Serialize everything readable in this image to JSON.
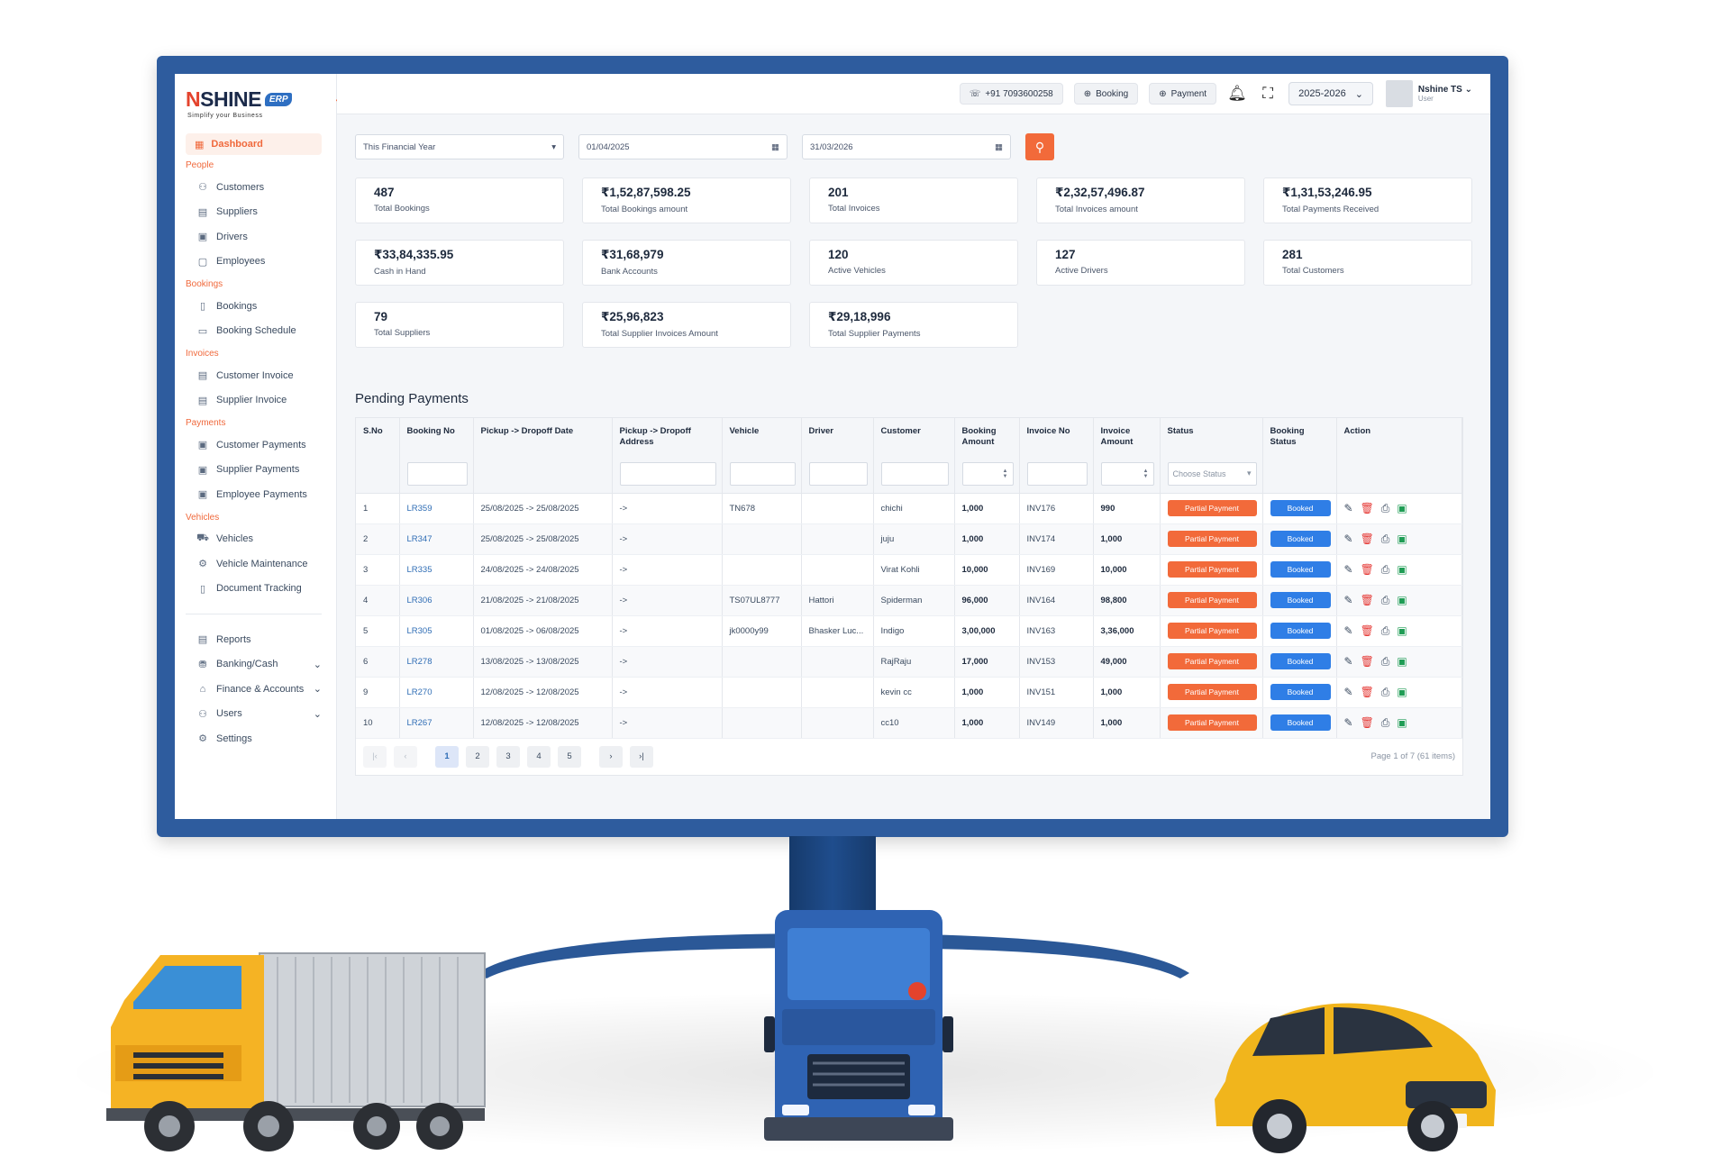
{
  "brand": {
    "name_initial": "N",
    "name_rest": "SHINE",
    "badge": "ERP",
    "tagline": "Simplify your Business"
  },
  "topbar": {
    "phone": "+91 7093600258",
    "booking_label": "Booking",
    "payment_label": "Payment",
    "year": "2025-2026",
    "user_name": "Nshine TS",
    "user_role": "User"
  },
  "sidebar": {
    "active": "Dashboard",
    "groups": [
      {
        "title": "People",
        "items": [
          "Customers",
          "Suppliers",
          "Drivers",
          "Employees"
        ]
      },
      {
        "title": "Bookings",
        "items": [
          "Bookings",
          "Booking Schedule"
        ]
      },
      {
        "title": "Invoices",
        "items": [
          "Customer Invoice",
          "Supplier Invoice"
        ]
      },
      {
        "title": "Payments",
        "items": [
          "Customer Payments",
          "Supplier Payments",
          "Employee Payments"
        ]
      },
      {
        "title": "Vehicles",
        "items": [
          "Vehicles",
          "Vehicle Maintenance",
          "Document Tracking"
        ]
      }
    ],
    "bottom": [
      "Reports",
      "Banking/Cash",
      "Finance & Accounts",
      "Users",
      "Settings"
    ]
  },
  "filters": {
    "period": "This Financial Year",
    "from_date": "01/04/2025",
    "to_date": "31/03/2026"
  },
  "stats": [
    {
      "value": "487",
      "label": "Total Bookings"
    },
    {
      "value": "₹1,52,87,598.25",
      "label": "Total Bookings amount"
    },
    {
      "value": "201",
      "label": "Total Invoices"
    },
    {
      "value": "₹2,32,57,496.87",
      "label": "Total Invoices amount"
    },
    {
      "value": "₹1,31,53,246.95",
      "label": "Total Payments Received"
    },
    {
      "value": "₹33,84,335.95",
      "label": "Cash in Hand"
    },
    {
      "value": "₹31,68,979",
      "label": "Bank Accounts"
    },
    {
      "value": "120",
      "label": "Active Vehicles"
    },
    {
      "value": "127",
      "label": "Active Drivers"
    },
    {
      "value": "281",
      "label": "Total Customers"
    },
    {
      "value": "79",
      "label": "Total Suppliers"
    },
    {
      "value": "₹25,96,823",
      "label": "Total Supplier Invoices Amount"
    },
    {
      "value": "₹29,18,996",
      "label": "Total Supplier Payments"
    }
  ],
  "pending": {
    "title": "Pending Payments",
    "columns": [
      "S.No",
      "Booking No",
      "Pickup -> Dropoff Date",
      "Pickup -> Dropoff Address",
      "Vehicle",
      "Driver",
      "Customer",
      "Booking Amount",
      "Invoice No",
      "Invoice Amount",
      "Status",
      "Booking Status",
      "Action"
    ],
    "status_placeholder": "Choose Status",
    "rows": [
      {
        "sno": "1",
        "booking": "LR359",
        "date": "25/08/2025 -> 25/08/2025",
        "addr": "->",
        "vehicle": "TN678",
        "driver": "",
        "customer": "chichi",
        "amount": "1,000",
        "invoice": "INV176",
        "inv_amount": "990",
        "status": "Partial Payment",
        "bstatus": "Booked"
      },
      {
        "sno": "2",
        "booking": "LR347",
        "date": "25/08/2025 -> 25/08/2025",
        "addr": "->",
        "vehicle": "",
        "driver": "",
        "customer": "juju",
        "amount": "1,000",
        "invoice": "INV174",
        "inv_amount": "1,000",
        "status": "Partial Payment",
        "bstatus": "Booked"
      },
      {
        "sno": "3",
        "booking": "LR335",
        "date": "24/08/2025 -> 24/08/2025",
        "addr": "->",
        "vehicle": "",
        "driver": "",
        "customer": "Virat Kohli",
        "amount": "10,000",
        "invoice": "INV169",
        "inv_amount": "10,000",
        "status": "Partial Payment",
        "bstatus": "Booked"
      },
      {
        "sno": "4",
        "booking": "LR306",
        "date": "21/08/2025 -> 21/08/2025",
        "addr": "->",
        "vehicle": "TS07UL8777",
        "driver": "Hattori",
        "customer": "Spiderman",
        "amount": "96,000",
        "invoice": "INV164",
        "inv_amount": "98,800",
        "status": "Partial Payment",
        "bstatus": "Booked"
      },
      {
        "sno": "5",
        "booking": "LR305",
        "date": "01/08/2025 -> 06/08/2025",
        "addr": "->",
        "vehicle": "jk0000y99",
        "driver": "Bhasker Luc...",
        "customer": "Indigo",
        "amount": "3,00,000",
        "invoice": "INV163",
        "inv_amount": "3,36,000",
        "status": "Partial Payment",
        "bstatus": "Booked"
      },
      {
        "sno": "6",
        "booking": "LR278",
        "date": "13/08/2025 -> 13/08/2025",
        "addr": "->",
        "vehicle": "",
        "driver": "",
        "customer": "RajRaju",
        "amount": "17,000",
        "invoice": "INV153",
        "inv_amount": "49,000",
        "status": "Partial Payment",
        "bstatus": "Booked"
      },
      {
        "sno": "9",
        "booking": "LR270",
        "date": "12/08/2025 -> 12/08/2025",
        "addr": "->",
        "vehicle": "",
        "driver": "",
        "customer": "kevin cc",
        "amount": "1,000",
        "invoice": "INV151",
        "inv_amount": "1,000",
        "status": "Partial Payment",
        "bstatus": "Booked"
      },
      {
        "sno": "10",
        "booking": "LR267",
        "date": "12/08/2025 -> 12/08/2025",
        "addr": "->",
        "vehicle": "",
        "driver": "",
        "customer": "cc10",
        "amount": "1,000",
        "invoice": "INV149",
        "inv_amount": "1,000",
        "status": "Partial Payment",
        "bstatus": "Booked"
      }
    ],
    "pages": [
      "1",
      "2",
      "3",
      "4",
      "5"
    ],
    "current_page": "1",
    "page_info": "Page 1 of 7 (61 items)"
  },
  "icons": {
    "headset": "headset-icon",
    "plus_circle": "plus-circle-icon",
    "bell": "bell-icon",
    "fullscreen": "fullscreen-icon",
    "calendar": "calendar-icon",
    "search": "search-icon",
    "edit": "pencil-icon",
    "delete": "trash-icon",
    "print": "printer-icon",
    "pay": "cash-icon"
  },
  "colors": {
    "accent": "#f26a3a",
    "primary": "#2f7ee6",
    "link": "#2f6db5",
    "bezel": "#2e5c9e"
  }
}
